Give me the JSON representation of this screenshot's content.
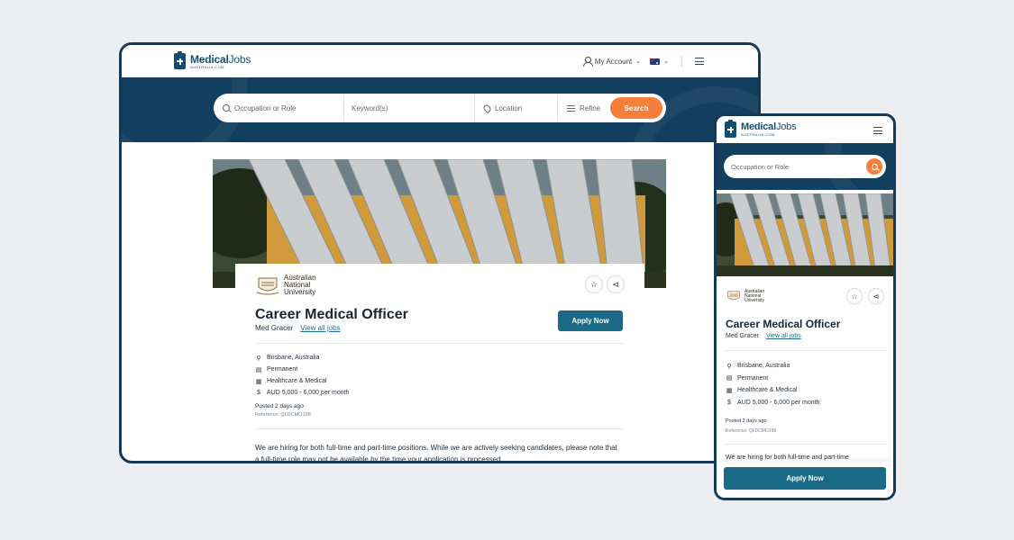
{
  "brand": {
    "name_bold": "Medical",
    "name_light": "Jobs",
    "tagline": "AUSTRALIA.COM"
  },
  "header": {
    "account_label": "My Account",
    "country": "Australia"
  },
  "search": {
    "occupation_placeholder": "Occupation or Role",
    "keyword_placeholder": "Keyword(s)",
    "location_placeholder": "Location",
    "refine_label": "Refine",
    "search_button": "Search"
  },
  "job": {
    "company_logo_text": [
      "Australian",
      "National",
      "University"
    ],
    "title": "Career Medical Officer",
    "advertiser": "Med Gracer",
    "view_all_link": "View all jobs",
    "apply_label": "Apply Now",
    "details": [
      {
        "icon": "location-pin-icon",
        "text": "Brisbane, Australia"
      },
      {
        "icon": "briefcase-icon",
        "text": "Permanent"
      },
      {
        "icon": "building-icon",
        "text": "Healthcare & Medical"
      },
      {
        "icon": "dollar-icon",
        "text": "AUD 5,000 - 6,000 per month"
      }
    ],
    "posted": "Posted 2 days ago",
    "reference": "Reference: QLDCMO198",
    "description_line1": "We are hiring for both full-time and part-time positions. While we are actively seeking candidates, please note that",
    "description_line2": "a full-time role may not be available by the time your application is processed.",
    "mobile_description_preview": "We are hiring for both full-time and part-time"
  },
  "colors": {
    "navy": "#123f5e",
    "accent_orange": "#f4803c",
    "apply_teal": "#1a6a88",
    "link_blue": "#1f6f98"
  }
}
